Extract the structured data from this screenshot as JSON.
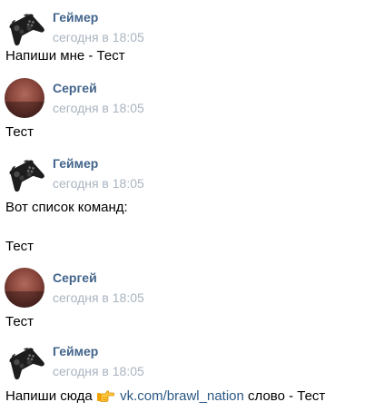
{
  "messages": [
    {
      "author": "Геймер",
      "time": "сегодня в 18:05",
      "avatar": "gamepad-icon",
      "lines": [
        "Напиши мне - Тест"
      ]
    },
    {
      "author": "Сергей",
      "time": "сегодня в 18:05",
      "avatar": "user-photo",
      "lines": [
        "Тест"
      ]
    },
    {
      "author": "Геймер",
      "time": "сегодня в 18:05",
      "avatar": "gamepad-icon",
      "lines": [
        "Вот список команд:",
        "Тест"
      ]
    },
    {
      "author": "Сергей",
      "time": "сегодня в 18:05",
      "avatar": "user-photo",
      "lines": [
        "Тест"
      ]
    },
    {
      "author": "Геймер",
      "time": "сегодня в 18:05",
      "avatar": "gamepad-icon",
      "text_before": "Напиши сюда",
      "emoji": "pointing-hand-icon",
      "link": "vk.com/brawl_nation",
      "text_after": "слово - Тест"
    }
  ],
  "colors": {
    "author": "#42648b",
    "time": "#a9b4c0",
    "link": "#2a5885",
    "text": "#000000"
  }
}
